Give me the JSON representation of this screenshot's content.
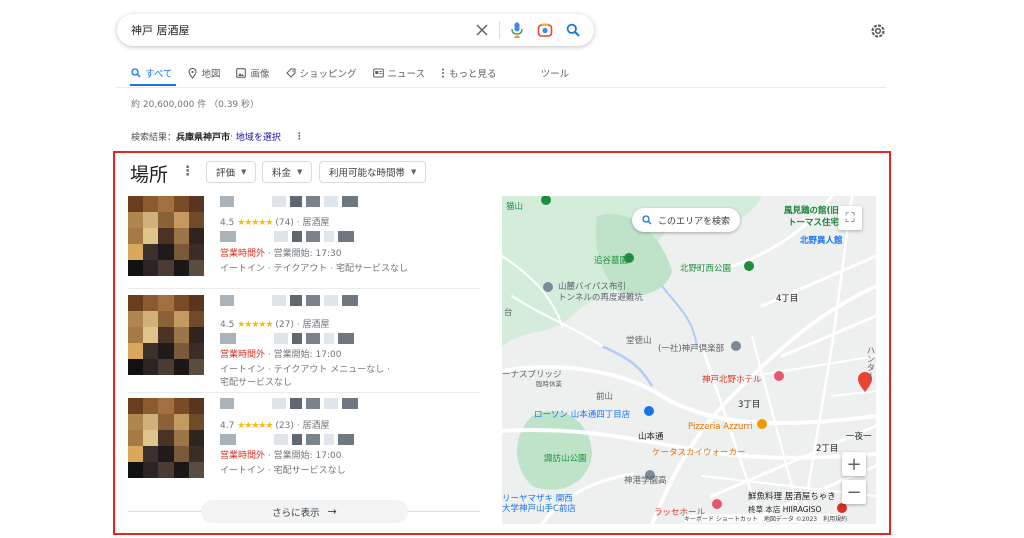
{
  "search": {
    "query": "神戸 居酒屋"
  },
  "tabs": [
    {
      "label": "すべて",
      "icon": "search-icon",
      "active": true
    },
    {
      "label": "地図",
      "icon": "map-pin-icon"
    },
    {
      "label": "画像",
      "icon": "image-icon"
    },
    {
      "label": "ショッピング",
      "icon": "tag-icon"
    },
    {
      "label": "ニュース",
      "icon": "news-icon"
    },
    {
      "label": "もっと見る",
      "icon": "more-vert-icon"
    },
    {
      "label": "ツール"
    }
  ],
  "stats": "約 20,600,000 件 （0.39 秒）",
  "location": {
    "prefix": "検索結果：",
    "place": "兵庫県神戸市",
    "sep": " · ",
    "link": "地域を選択"
  },
  "local_pack": {
    "title": "場所",
    "filters": [
      "評価",
      "料金",
      "利用可能な時間帯"
    ],
    "results": [
      {
        "rating": "4.5",
        "stars": "★★★★★",
        "reviews": "(74)",
        "category": "居酒屋",
        "status_closed": "営業時間外",
        "status_rest": " · 営業開始: 17:30",
        "services_1": "イートイン · テイクアウト · 宅配サービスなし",
        "services_2": ""
      },
      {
        "rating": "4.5",
        "stars": "★★★★★",
        "reviews": "(27)",
        "category": "居酒屋",
        "status_closed": "営業時間外",
        "status_rest": " · 営業開始: 17:00",
        "services_1": "イートイン · テイクアウト メニューなし ·",
        "services_2": "宅配サービスなし"
      },
      {
        "rating": "4.7",
        "stars": "★★★★★",
        "reviews": "(23)",
        "category": "居酒屋",
        "status_closed": "営業時間外",
        "status_rest": " · 営業開始: 17:00",
        "services_1": "イートイン · 宅配サービスなし",
        "services_2": ""
      }
    ],
    "more_label": "さらに表示"
  },
  "map": {
    "search_area": "このエリアを検索",
    "labels": {
      "kazamidori": "風見鶏の館(旧",
      "thomas": "トーマス住宅",
      "kitano_ijinkan": "北野異人館",
      "oitani": "追谷墓園",
      "kitano_park": "北野町西公園",
      "bypass_1": "山麓バイパス布引",
      "bypass_2": "トンネルの再度避難坑",
      "dotokuyama": "堂徳山",
      "club": "(一社)神戸倶楽部",
      "bridge": "ーナスブリッジ",
      "rest": "臨時休業",
      "maeyama": "前山",
      "hotel": "神戸北野ホテル",
      "lawson": "ローソン 山本通四丁目店",
      "yamamoto": "山本通",
      "pizzeria": "Pizzeria Azzurri",
      "kakesu": "ケータスカイウォーカー",
      "suwayama": "諏訪山公園",
      "shinko": "神港学園高",
      "ryuya_1": "リーヤマザキ 関西",
      "ryuya_2": "大学神戸山手C前店",
      "lasse": "ラッセホール",
      "sengyo": "鮮魚料理 居酒屋ちゃき",
      "hiiragi": "柊草 本店 HIIRAGISO",
      "cho4": "4丁目",
      "cho3": "3丁目",
      "cho2": "2丁目",
      "cho1": "一夜一",
      "nunodai": "台",
      "hanta": "ハンター",
      "taki": "猫山"
    },
    "attribution": "キーボード ショートカット　地図データ ©2023　利用規約"
  },
  "colors": {
    "accent": "#1a73e8",
    "frame": "#e52521",
    "closed": "#d93025",
    "star": "#fbbc04"
  }
}
